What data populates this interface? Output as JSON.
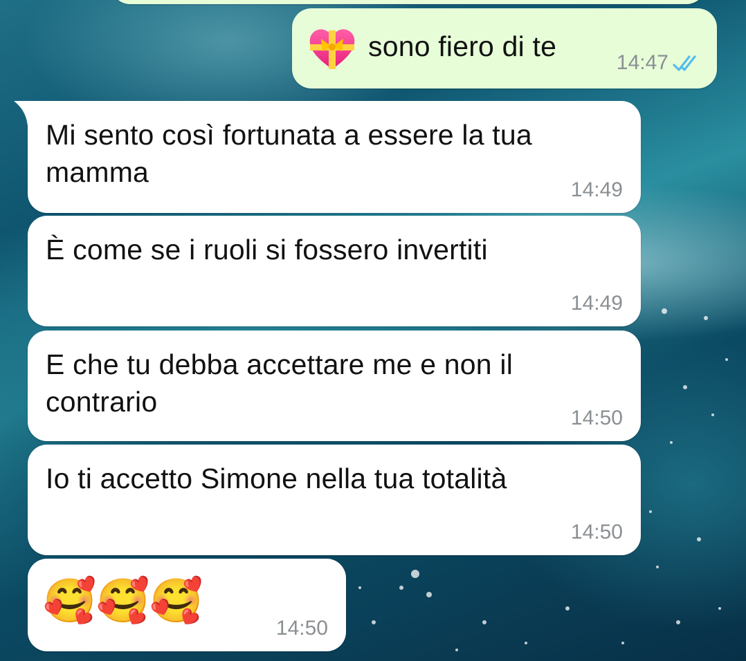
{
  "chat": {
    "outgoing": {
      "text": "sono fiero di te",
      "time": "14:47",
      "emoji_icon": "heart-with-ribbon-icon",
      "status_icon": "double-check-read-icon",
      "status_color": "#53bdeb"
    },
    "incoming": [
      {
        "text": "Mi sento così fortunata a essere la tua\nmamma",
        "time": "14:49"
      },
      {
        "text": "È come se i ruoli si fossero invertiti",
        "time": "14:49"
      },
      {
        "text": "E che tu debba accettare me e non il\ncontrario",
        "time": "14:50"
      },
      {
        "text": "Io ti accetto Simone nella tua totalità",
        "time": "14:50"
      },
      {
        "text": "🥰🥰🥰",
        "time": "14:50"
      }
    ]
  },
  "colors": {
    "outgoing_bubble": "#e7fdd8",
    "incoming_bubble": "#ffffff",
    "time_text": "#8a8f93"
  }
}
